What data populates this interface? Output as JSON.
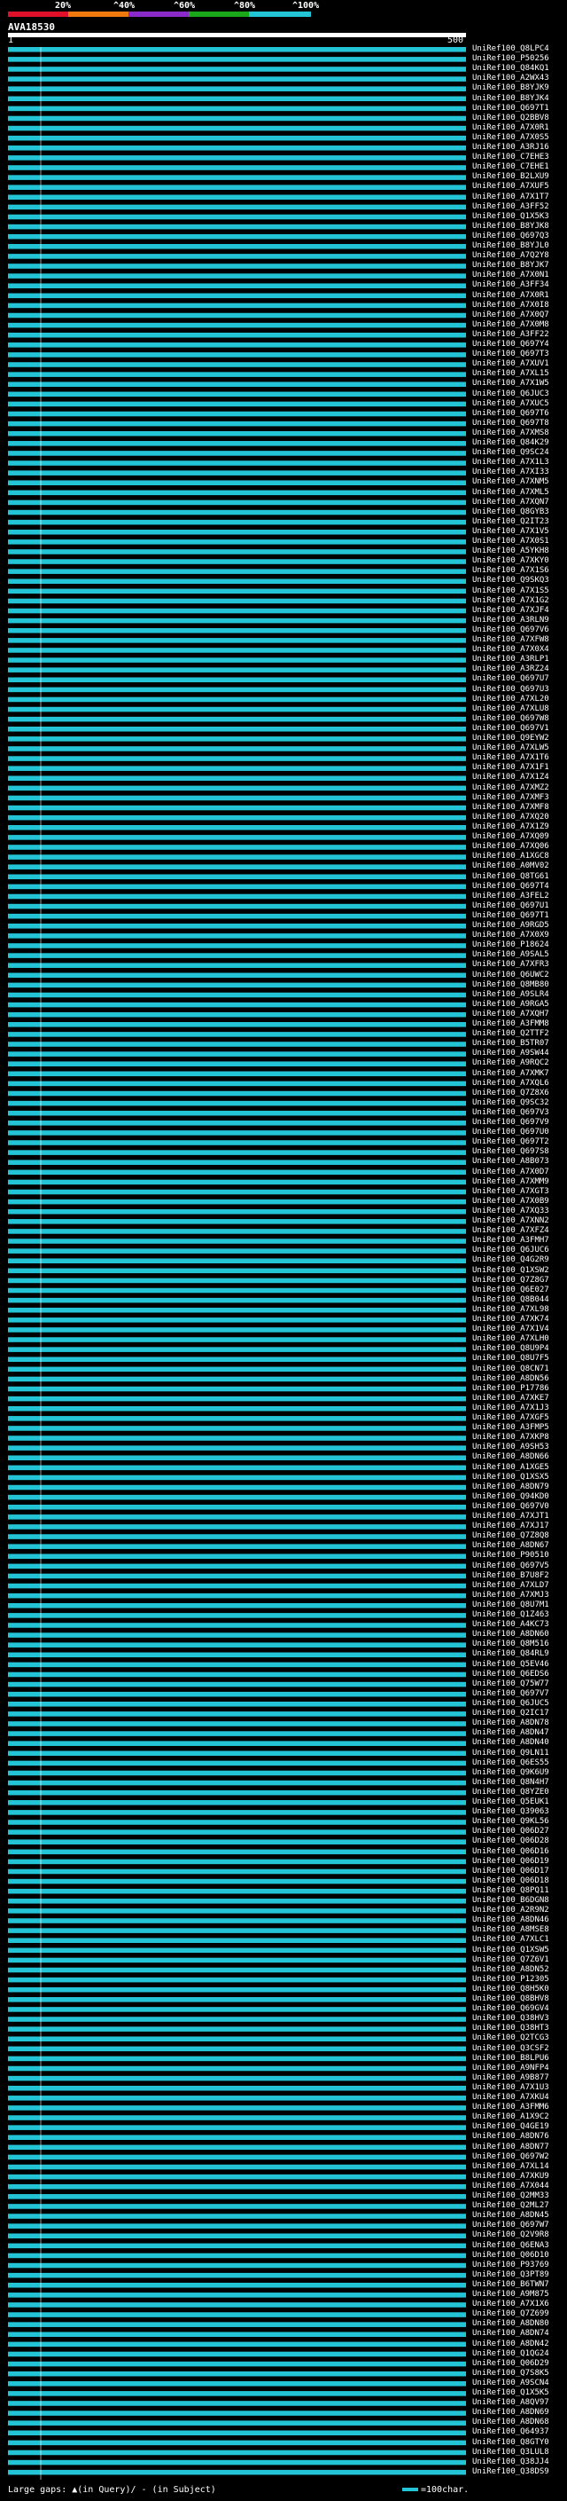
{
  "header": {
    "percent_labels": [
      "20%",
      "^40%",
      "^60%",
      "^80%",
      "^100%"
    ],
    "colors": [
      "#e0102a",
      "#f07a10",
      "#8a2ac8",
      "#1aa81a",
      "#22c4d6"
    ]
  },
  "query": {
    "name": "AVA18530",
    "start_label": "1",
    "end_label": "500"
  },
  "legend": {
    "text": "Large gaps: ▲(in Query)/ - (in Subject)",
    "scale_text": "=100char."
  },
  "colors": {
    "hit_cyan": "#22c4d6",
    "hit_green": "#1aa81a",
    "background": "#000000"
  },
  "hits": [
    "UniRef100_Q8LPC4",
    "UniRef100_P50256",
    "UniRef100_Q84KQ1",
    "UniRef100_A2WX43",
    "UniRef100_B8YJK9",
    "UniRef100_B8YJK4",
    "UniRef100_Q697T1",
    "UniRef100_Q2BBV8",
    "UniRef100_A7X0R1",
    "UniRef100_A7X0S5",
    "UniRef100_A3RJ16",
    "UniRef100_C7EHE3",
    "UniRef100_C7EHE1",
    "UniRef100_B2LXU9",
    "UniRef100_A7XUF5",
    "UniRef100_A7X1T7",
    "UniRef100_A3FF52",
    "UniRef100_Q1X5K3",
    "UniRef100_B8YJK8",
    "UniRef100_Q697Q3",
    "UniRef100_B8YJL0",
    "UniRef100_A7Q2Y8",
    "UniRef100_B8YJK7",
    "UniRef100_A7X0N1",
    "UniRef100_A3FF34",
    "UniRef100_A7X0R1",
    "UniRef100_A7X0I8",
    "UniRef100_A7X0Q7",
    "UniRef100_A7X0M8",
    "UniRef100_A3FF22",
    "UniRef100_Q697Y4",
    "UniRef100_Q697T3",
    "UniRef100_A7XUV1",
    "UniRef100_A7XL15",
    "UniRef100_A7X1W5",
    "UniRef100_Q6JUC3",
    "UniRef100_A7XUC5",
    "UniRef100_Q697T6",
    "UniRef100_Q697T8",
    "UniRef100_A7XMS8",
    "UniRef100_Q84K29",
    "UniRef100_Q9SC24",
    "UniRef100_A7X1L3",
    "UniRef100_A7XI33",
    "UniRef100_A7XNM5",
    "UniRef100_A7XML5",
    "UniRef100_A7XQN7",
    "UniRef100_Q8GYB3",
    "UniRef100_Q2IT23",
    "UniRef100_A7X1V5",
    "UniRef100_A7X0S1",
    "UniRef100_A5YKH8",
    "UniRef100_A7XKY0",
    "UniRef100_A7X1S6",
    "UniRef100_Q9SKQ3",
    "UniRef100_A7X1S5",
    "UniRef100_A7X1G2",
    "UniRef100_A7XJF4",
    "UniRef100_A3RLN9",
    "UniRef100_Q697V6",
    "UniRef100_A7XFW8",
    "UniRef100_A7X0X4",
    "UniRef100_A3RLP1",
    "UniRef100_A3RZ24",
    "UniRef100_Q697U7",
    "UniRef100_Q697U3",
    "UniRef100_A7XL20",
    "UniRef100_A7XLU8",
    "UniRef100_Q697W8",
    "UniRef100_Q697V1",
    "UniRef100_Q9EYW2",
    "UniRef100_A7XLW5",
    "UniRef100_A7X1T6",
    "UniRef100_A7X1F1",
    "UniRef100_A7X1Z4",
    "UniRef100_A7XMZ2",
    "UniRef100_A7XMF3",
    "UniRef100_A7XMF8",
    "UniRef100_A7XQ20",
    "UniRef100_A7X1Z9",
    "UniRef100_A7XQ09",
    "UniRef100_A7XQ06",
    "UniRef100_A1XGC8",
    "UniRef100_A0MV02",
    "UniRef100_Q8TG61",
    "UniRef100_Q697T4",
    "UniRef100_A3FEL2",
    "UniRef100_Q697U1",
    "UniRef100_Q697T1",
    "UniRef100_A9RGD5",
    "UniRef100_A7X0X9",
    "UniRef100_P18624",
    "UniRef100_A9SAL5",
    "UniRef100_A7XFR3",
    "UniRef100_Q6UWC2",
    "UniRef100_Q8MB80",
    "UniRef100_A9SLR4",
    "UniRef100_A9RGA5",
    "UniRef100_A7XQH7",
    "UniRef100_A3FMM8",
    "UniRef100_Q2TTF2",
    "UniRef100_B5TR07",
    "UniRef100_A9SW44",
    "UniRef100_A9RQC2",
    "UniRef100_A7XMK7",
    "UniRef100_A7XQL6",
    "UniRef100_Q7Z8X6",
    "UniRef100_Q9SC32",
    "UniRef100_Q697V3",
    "UniRef100_Q697V9",
    "UniRef100_Q697U0",
    "UniRef100_Q697T2",
    "UniRef100_Q697S8",
    "UniRef100_A8B073",
    "UniRef100_A7X0D7",
    "UniRef100_A7XMM9",
    "UniRef100_A7XGT3",
    "UniRef100_A7X0B9",
    "UniRef100_A7XQ33",
    "UniRef100_A7XNN2",
    "UniRef100_A7XFZ4",
    "UniRef100_A3FMH7",
    "UniRef100_Q6JUC6",
    "UniRef100_Q4G2R9",
    "UniRef100_Q1XSW2",
    "UniRef100_Q7Z8G7",
    "UniRef100_Q6E027",
    "UniRef100_Q8B044",
    "UniRef100_A7XL98",
    "UniRef100_A7XK74",
    "UniRef100_A7X1V4",
    "UniRef100_A7XLH0",
    "UniRef100_Q8U9P4",
    "UniRef100_Q8U7F5",
    "UniRef100_Q8CN71",
    "UniRef100_A8DN56",
    "UniRef100_P17786",
    "UniRef100_A7XKE7",
    "UniRef100_A7X1J3",
    "UniRef100_A7XGF5",
    "UniRef100_A3FMP5",
    "UniRef100_A7XKP8",
    "UniRef100_A9SH53",
    "UniRef100_A8DN66",
    "UniRef100_A1XGE5",
    "UniRef100_Q1XSX5",
    "UniRef100_A8DN79",
    "UniRef100_Q94KD0",
    "UniRef100_Q697V0",
    "UniRef100_A7XJT1",
    "UniRef100_A7XJ17",
    "UniRef100_Q7Z8Q8",
    "UniRef100_A8DN67",
    "UniRef100_P90510",
    "UniRef100_Q697V5",
    "UniRef100_B7U8F2",
    "UniRef100_A7XLD7",
    "UniRef100_A7XMJ3",
    "UniRef100_Q8U7M1",
    "UniRef100_Q1Z463",
    "UniRef100_A4KC73",
    "UniRef100_A8DN60",
    "UniRef100_Q8M516",
    "UniRef100_Q84RL9",
    "UniRef100_Q5EV46",
    "UniRef100_Q6EDS6",
    "UniRef100_Q75W77",
    "UniRef100_Q697V7",
    "UniRef100_Q6JUC5",
    "UniRef100_Q2IC17",
    "UniRef100_A8DN78",
    "UniRef100_A8DN47",
    "UniRef100_A8DN40",
    "UniRef100_Q9LN11",
    "UniRef100_Q6ES55",
    "UniRef100_Q9K6U9",
    "UniRef100_Q8N4H7",
    "UniRef100_Q8YZE0",
    "UniRef100_Q5EUK1",
    "UniRef100_Q39063",
    "UniRef100_Q9KL56",
    "UniRef100_Q06D27",
    "UniRef100_Q06D28",
    "UniRef100_Q06D16",
    "UniRef100_Q06D19",
    "UniRef100_Q06D17",
    "UniRef100_Q06D18",
    "UniRef100_Q8PQ11",
    "UniRef100_B6DGN8",
    "UniRef100_A2R9N2",
    "UniRef100_A8DN46",
    "UniRef100_A8MSE8",
    "UniRef100_A7XLC1",
    "UniRef100_Q1XSW5",
    "UniRef100_Q7Z6V1",
    "UniRef100_A8DN52",
    "UniRef100_P12305",
    "UniRef100_Q8H5K0",
    "UniRef100_Q8BHV8",
    "UniRef100_Q69GV4",
    "UniRef100_Q38HV3",
    "UniRef100_Q38HT3",
    "UniRef100_Q2TCG3",
    "UniRef100_Q3CSF2",
    "UniRef100_B8LPU6",
    "UniRef100_A9NFP4",
    "UniRef100_A9B877",
    "UniRef100_A7X1U3",
    "UniRef100_A7XKU4",
    "UniRef100_A3FMM6",
    "UniRef100_A1X9C2",
    "UniRef100_Q4GE19",
    "UniRef100_A8DN76",
    "UniRef100_A8DN77",
    "UniRef100_Q697W2",
    "UniRef100_A7XL14",
    "UniRef100_A7XKU9",
    "UniRef100_A7X044",
    "UniRef100_Q2MM33",
    "UniRef100_Q2ML27",
    "UniRef100_A8DN45",
    "UniRef100_Q697W7",
    "UniRef100_Q2V9R8",
    "UniRef100_Q6ENA3",
    "UniRef100_Q06D10",
    "UniRef100_P93769",
    "UniRef100_Q3PT89",
    "UniRef100_B6TWN7",
    "UniRef100_A9M875",
    "UniRef100_A7X1X6",
    "UniRef100_Q7Z699",
    "UniRef100_A8DN80",
    "UniRef100_A8DN74",
    "UniRef100_A8DN42",
    "UniRef100_Q1QG24",
    "UniRef100_Q06D29",
    "UniRef100_Q7S8K5",
    "UniRef100_A9SCN4",
    "UniRef100_Q1X5K5",
    "UniRef100_A8QV97",
    "UniRef100_A8DN69",
    "UniRef100_A8DN68",
    "UniRef100_Q64937",
    "UniRef100_Q8GTY0",
    "UniRef100_Q3LUL8",
    "UniRef100_Q38JJ4",
    "UniRef100_Q38DS9"
  ]
}
